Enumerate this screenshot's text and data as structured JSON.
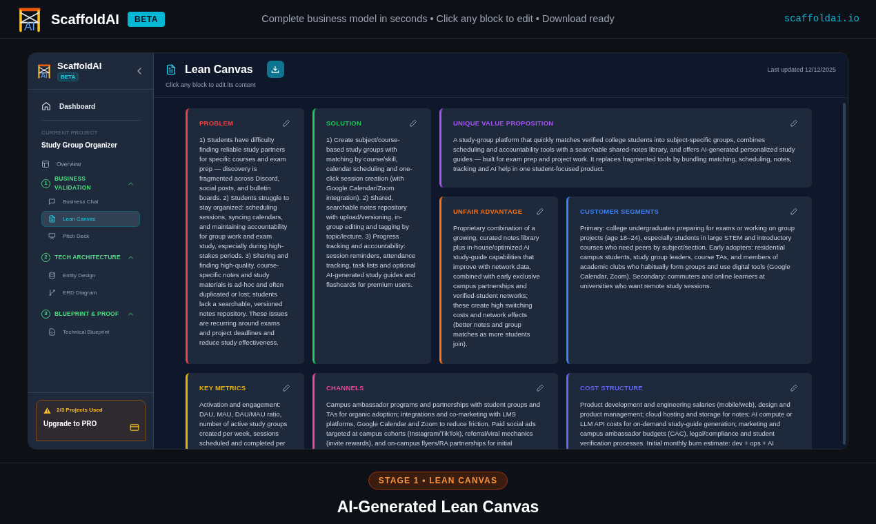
{
  "top_bar": {
    "logo_mark": "AI",
    "brand": "ScaffoldAI",
    "badge": "BETA",
    "tagline": "Complete business model in seconds • Click any block to edit • Download ready",
    "link": "scaffoldai.io"
  },
  "sidebar": {
    "logo_mark": "AI",
    "brand": "ScaffoldAI",
    "badge": "BETA",
    "dashboard": "Dashboard",
    "project_label": "CURRENT PROJECT",
    "project_name": "Study Group Organizer",
    "overview": "Overview",
    "sections": [
      {
        "number": "1",
        "title": "BUSINESS VALIDATION",
        "expanded": true,
        "items": [
          {
            "label": "Business Chat",
            "selected": false
          },
          {
            "label": "Lean Canvas",
            "selected": true
          },
          {
            "label": "Pitch Deck",
            "selected": false
          }
        ]
      },
      {
        "number": "2",
        "title": "TECH ARCHITECTURE",
        "expanded": true,
        "items": [
          {
            "label": "Entity Design",
            "selected": false
          },
          {
            "label": "ERD Diagram",
            "selected": false
          }
        ]
      },
      {
        "number": "3",
        "title": "BLUEPRINT & PROOF",
        "expanded": true,
        "items": [
          {
            "label": "Technical Blueprint",
            "selected": false
          }
        ]
      }
    ],
    "upgrade": {
      "usage": "2/3 Projects Used",
      "title": "Upgrade to PRO"
    }
  },
  "header": {
    "title": "Lean Canvas",
    "subtitle": "Click any block to edit its content",
    "updated": "Last updated 12/12/2025"
  },
  "blocks": [
    {
      "title": "PROBLEM",
      "color": "#ef4444",
      "text": "1) Students have difficulty finding reliable study partners for specific courses and exam prep — discovery is fragmented across Discord, social posts, and bulletin boards. 2) Students struggle to stay organized: scheduling sessions, syncing calendars, and maintaining accountability for group work and exam study, especially during high-stakes periods. 3) Sharing and finding high-quality, course-specific notes and study materials is ad-hoc and often duplicated or lost; students lack a searchable, versioned notes repository. These issues are recurring around exams and project deadlines and reduce study effectiveness."
    },
    {
      "title": "SOLUTION",
      "color": "#22c55e",
      "text": "1) Create subject/course-based study groups with matching by course/skill, calendar scheduling and one-click session creation (with Google Calendar/Zoom integration). 2) Shared, searchable notes repository with upload/versioning, in-group editing and tagging by topic/lecture. 3) Progress tracking and accountability: session reminders, attendance tracking, task lists and optional AI-generated study guides and flashcards for premium users."
    },
    {
      "title": "UNIQUE VALUE PROPOSITION",
      "color": "#a855f7",
      "text": "A study-group platform that quickly matches verified college students into subject-specific groups, combines scheduling and accountability tools with a searchable shared-notes library, and offers AI-generated personalized study guides — built for exam prep and project work. It replaces fragmented tools by bundling matching, scheduling, notes, tracking and AI help in one student-focused product."
    },
    {
      "title": "UNFAIR ADVANTAGE",
      "color": "#f97316",
      "text": "Proprietary combination of a growing, curated notes library plus in-house/optimized AI study-guide capabilities that improve with network data, combined with early exclusive campus partnerships and verified-student networks; these create high switching costs and network effects (better notes and group matches as more students join)."
    },
    {
      "title": "CUSTOMER SEGMENTS",
      "color": "#3b82f6",
      "text": "Primary: college undergraduates preparing for exams or working on group projects (age 18–24), especially students in large STEM and introductory courses who need peers by subject/section. Early adopters: residential campus students, study group leaders, course TAs, and members of academic clubs who habitually form groups and use digital tools (Google Calendar, Zoom). Secondary: commuters and online learners at universities who want remote study sessions."
    },
    {
      "title": "KEY METRICS",
      "color": "#eab308",
      "text": "Activation and engagement: DAU, MAU, DAU/MAU ratio, number of active study groups created per week, sessions scheduled and completed per"
    },
    {
      "title": "CHANNELS",
      "color": "#ec4899",
      "text": "Campus ambassador programs and partnerships with student groups and TAs for organic adoption; integrations and co-marketing with LMS platforms, Google Calendar and Zoom to reduce friction. Paid social ads targeted at campus cohorts (Instagram/TikTok), referral/viral mechanics (invite rewards), and on-campus flyers/RA partnerships for initial"
    },
    {
      "title": "COST STRUCTURE",
      "color": "#6366f1",
      "text": "Product development and engineering salaries (mobile/web), design and product management; cloud hosting and storage for notes; AI compute or LLM API costs for on-demand study-guide generation; marketing and campus ambassador budgets (CAC), legal/compliance and student verification processes. Initial monthly burn estimate: dev + ops + AI"
    }
  ],
  "footer": {
    "stage": "STAGE 1 • LEAN CANVAS",
    "title": "AI-Generated Lean Canvas"
  }
}
